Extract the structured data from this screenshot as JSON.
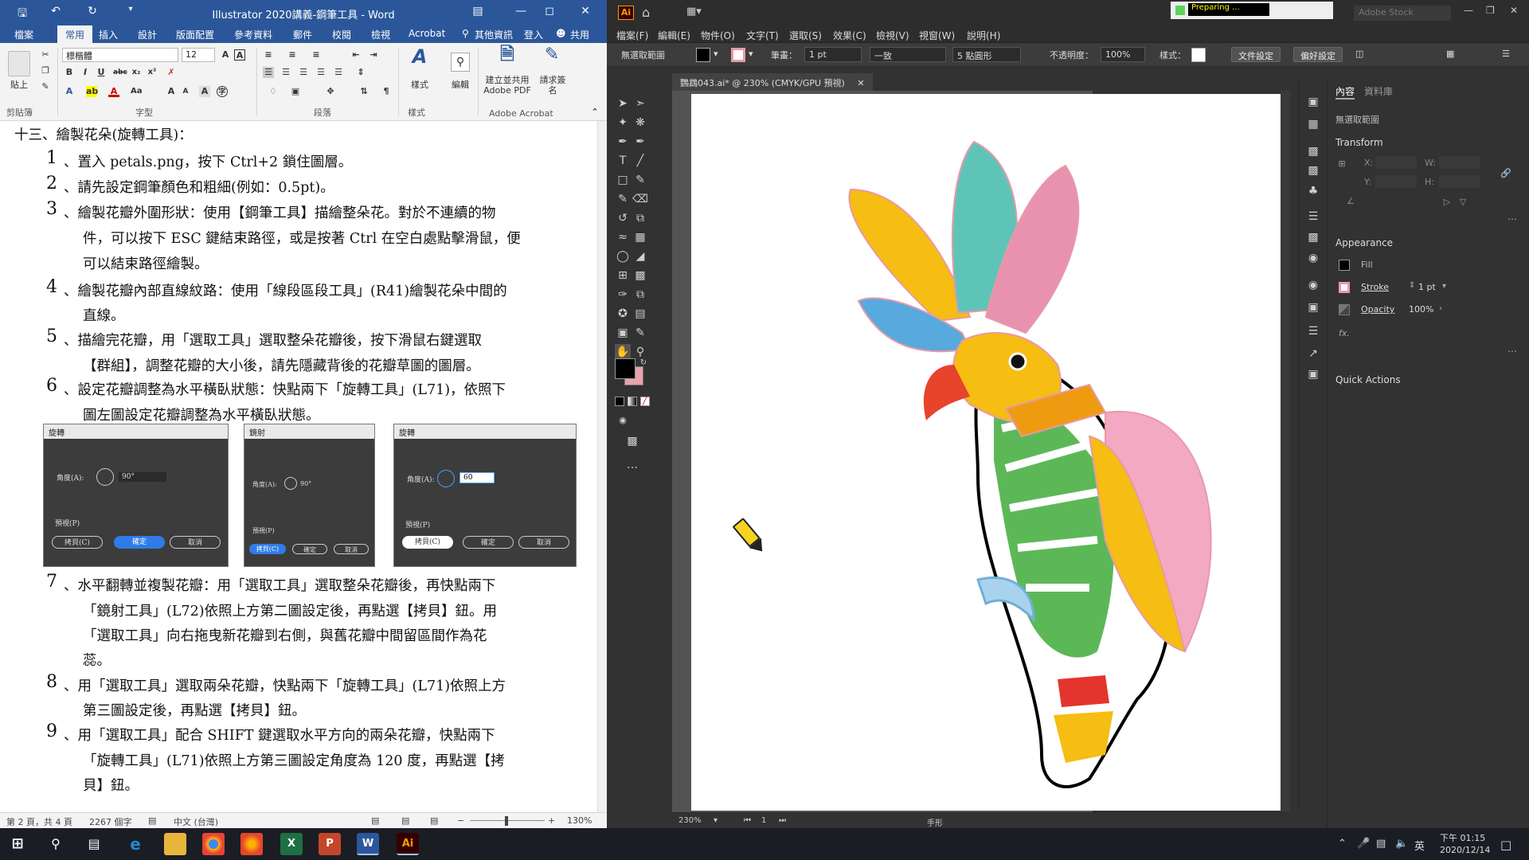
{
  "word": {
    "title": "Illustrator 2020講義-鋼筆工具 - Word",
    "tabs": [
      "檔案",
      "常用",
      "插入",
      "設計",
      "版面配置",
      "參考資料",
      "郵件",
      "校閱",
      "檢視",
      "Acrobat"
    ],
    "tell_me": "其他資訊",
    "sign_in": "登入",
    "share": "共用",
    "ribbon": {
      "paste": "貼上",
      "font_name": "標楷體",
      "font_size": "12",
      "styles": "樣式",
      "editing": "編輯",
      "create_pdf": "建立並共用 Adobe PDF",
      "request_sign": "請求簽名",
      "groups": [
        "剪貼簿",
        "字型",
        "段落",
        "樣式",
        "Adobe Acrobat"
      ]
    },
    "doc": {
      "heading": "十三、繪製花朵(旋轉工具)：",
      "items": [
        {
          "num": "1",
          "lines": [
            "、置入 petals.png，按下 Ctrl+2 鎖住圖層。"
          ]
        },
        {
          "num": "2",
          "lines": [
            "、請先設定鋼筆顏色和粗細(例如：0.5pt)。"
          ]
        },
        {
          "num": "3",
          "lines": [
            "、繪製花瓣外圍形狀：使用【鋼筆工具】描繪整朵花。對於不連續的物",
            "件，可以按下 ESC 鍵結束路徑，或是按著 Ctrl 在空白處點擊滑鼠，便",
            "可以結束路徑繪製。"
          ]
        },
        {
          "num": "4",
          "lines": [
            "、繪製花瓣內部直線紋路：使用「線段區段工具」(R41)繪製花朵中間的",
            "直線。"
          ]
        },
        {
          "num": "5",
          "lines": [
            "、描繪完花瓣，用「選取工具」選取整朵花瓣後，按下滑鼠右鍵選取",
            "【群組】，調整花瓣的大小後，請先隱藏背後的花瓣草圖的圖層。"
          ]
        },
        {
          "num": "6",
          "lines": [
            "、設定花瓣調整為水平橫臥狀態：快點兩下「旋轉工具」(L71)，依照下",
            "圖左圖設定花瓣調整為水平橫臥狀態。"
          ]
        },
        {
          "num": "7",
          "lines": [
            "、水平翻轉並複製花瓣：用「選取工具」選取整朵花瓣後，再快點兩下",
            "「鏡射工具」(L72)依照上方第二圖設定後，再點選【拷貝】鈕。用",
            "「選取工具」向右拖曳新花瓣到右側，與舊花瓣中間留區間作為花",
            "蕊。"
          ]
        },
        {
          "num": "8",
          "lines": [
            "、用「選取工具」選取兩朵花瓣，快點兩下「旋轉工具」(L71)依照上方",
            "第三圖設定後，再點選【拷貝】鈕。"
          ]
        },
        {
          "num": "9",
          "lines": [
            "、用「選取工具」配合 SHIFT 鍵選取水平方向的兩朵花瓣，快點兩下",
            "「旋轉工具」(L71)依照上方第三圖設定角度為 120 度，再點選【拷",
            "貝】鈕。"
          ]
        }
      ],
      "dialogs": [
        {
          "title": "旋轉",
          "angle_label": "角度(A):",
          "angle": "90°",
          "preview": "預視(P)",
          "copy": "拷貝(C)",
          "ok": "確定",
          "cancel": "取消"
        },
        {
          "title": "鏡射",
          "angle_label": "角度(A):",
          "angle": "90°",
          "preview": "預視(P)",
          "copy": "拷貝(C)",
          "ok": "確定",
          "cancel": "取消"
        },
        {
          "title": "旋轉",
          "angle_label": "角度(A):",
          "angle": "60",
          "preview": "預視(P)",
          "copy": "拷貝(C)",
          "ok": "確定",
          "cancel": "取消"
        }
      ]
    },
    "status": {
      "page": "第 2 頁，共 4 頁",
      "words": "2267 個字",
      "lang": "中文 (台灣)",
      "zoom": "130%"
    }
  },
  "illustrator": {
    "logo": "Ai",
    "preparing": "Preparing ...",
    "search_placeholder": "Adobe Stock",
    "menu": [
      "檔案(F)",
      "編輯(E)",
      "物件(O)",
      "文字(T)",
      "選取(S)",
      "效果(C)",
      "檢視(V)",
      "視窗(W)",
      "說明(H)"
    ],
    "control": {
      "no_selection": "無選取範圍",
      "stroke_label": "筆畫：",
      "stroke_weight": "1 pt",
      "stroke_style": "一致",
      "brush": "5 點圓形",
      "opacity_label": "不透明度：",
      "opacity": "100%",
      "style_label": "樣式：",
      "doc_setup": "文件設定",
      "prefs": "偏好設定"
    },
    "doc_tab": "鸚鵡043.ai* @ 230% (CMYK/GPU 預視)",
    "panel": {
      "tabs": [
        "內容",
        "資料庫"
      ],
      "no_selection": "無選取範圍",
      "transform": "Transform",
      "x_label": "X:",
      "y_label": "Y:",
      "w_label": "W:",
      "h_label": "H:",
      "appearance": "Appearance",
      "fill": "Fill",
      "stroke": "Stroke",
      "stroke_weight": "1 pt",
      "opacity": "Opacity",
      "opacity_value": "100%",
      "fx": "fx.",
      "quick_actions": "Quick Actions"
    },
    "status": {
      "zoom": "230%",
      "page": "1",
      "tool": "手形"
    }
  },
  "taskbar": {
    "time": "下午 01:15",
    "date": "2020/12/14",
    "ime": "英"
  },
  "colors": {
    "word_blue": "#2b579a",
    "ai_orange": "#ff9a00",
    "ai_dark": "#323232"
  }
}
